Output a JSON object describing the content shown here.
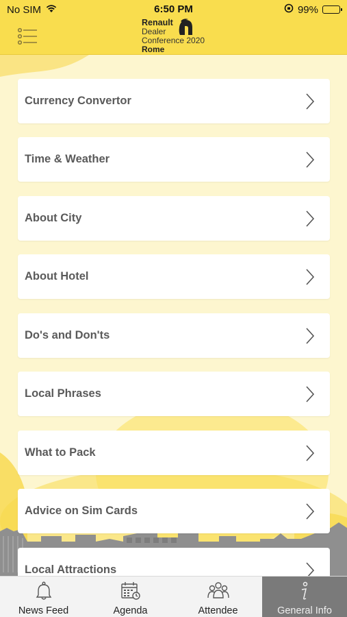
{
  "status_bar": {
    "carrier": "No SIM",
    "time": "6:50 PM",
    "battery": "99%"
  },
  "header": {
    "logo_line1": "Renault",
    "logo_line2": "Dealer",
    "logo_line3": "Conference 2020",
    "logo_line4": "Rome"
  },
  "items": [
    {
      "label": "Currency Convertor"
    },
    {
      "label": "Time & Weather"
    },
    {
      "label": "About City"
    },
    {
      "label": "About Hotel"
    },
    {
      "label": "Do's and Don'ts"
    },
    {
      "label": "Local Phrases"
    },
    {
      "label": "What to Pack"
    },
    {
      "label": "Advice on Sim Cards"
    },
    {
      "label": "Local Attractions"
    }
  ],
  "tabs": [
    {
      "label": "News Feed",
      "icon": "bell-icon"
    },
    {
      "label": "Agenda",
      "icon": "calendar-icon"
    },
    {
      "label": "Attendee",
      "icon": "people-icon"
    },
    {
      "label": "General Info",
      "icon": "info-icon",
      "active": true
    }
  ],
  "colors": {
    "accent": "#f9dd4e",
    "background": "#fdf6cf",
    "label": "#5a5a5a",
    "active_tab": "#7a7a7a"
  }
}
